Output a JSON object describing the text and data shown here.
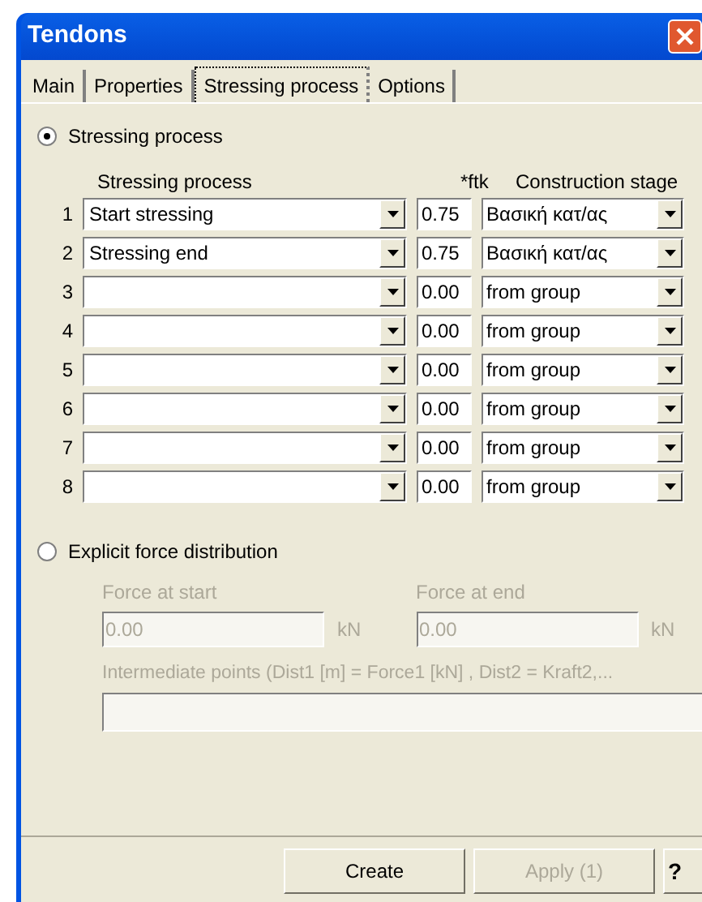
{
  "window": {
    "title": "Tendons"
  },
  "tabs": [
    {
      "label": "Main",
      "selected": false
    },
    {
      "label": "Properties",
      "selected": false
    },
    {
      "label": "Stressing process",
      "selected": true
    },
    {
      "label": "Options",
      "selected": false
    }
  ],
  "modes": [
    {
      "label": "Stressing process",
      "selected": true
    },
    {
      "label": "Explicit force distribution",
      "selected": false
    }
  ],
  "table": {
    "columns": [
      "Stressing process",
      "*ftk",
      "Construction stage"
    ],
    "rows": [
      {
        "number": "1",
        "process": "Start stressing",
        "ftk": "0.75",
        "stage": "Βασική κατ/ας"
      },
      {
        "number": "2",
        "process": "Stressing end",
        "ftk": "0.75",
        "stage": "Βασική κατ/ας"
      },
      {
        "number": "3",
        "process": "",
        "ftk": "0.00",
        "stage": "from group"
      },
      {
        "number": "4",
        "process": "",
        "ftk": "0.00",
        "stage": "from group"
      },
      {
        "number": "5",
        "process": "",
        "ftk": "0.00",
        "stage": "from group"
      },
      {
        "number": "6",
        "process": "",
        "ftk": "0.00",
        "stage": "from group"
      },
      {
        "number": "7",
        "process": "",
        "ftk": "0.00",
        "stage": "from group"
      },
      {
        "number": "8",
        "process": "",
        "ftk": "0.00",
        "stage": "from group"
      }
    ]
  },
  "explicit": {
    "disabled": true,
    "force_start": {
      "label": "Force at start",
      "value": "0.00",
      "unit": "kN"
    },
    "force_end": {
      "label": "Force at end",
      "value": "0.00",
      "unit": "kN"
    },
    "intermediate_label": "Intermediate points  (Dist1 [m] = Force1 [kN] , Dist2 = Kraft2,..."
  },
  "buttons": [
    {
      "kind": "text",
      "label": "Create",
      "disabled": false
    },
    {
      "kind": "text",
      "label": "Apply (1)",
      "disabled": true
    },
    {
      "kind": "help",
      "label": "?",
      "disabled": false
    }
  ]
}
